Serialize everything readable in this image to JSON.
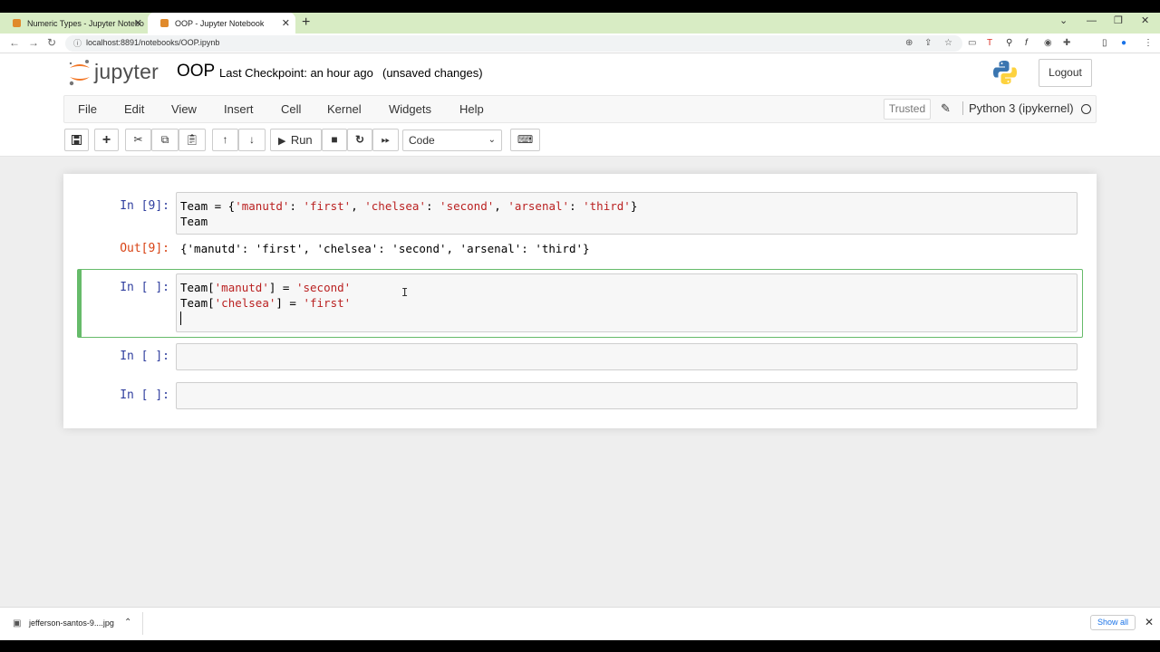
{
  "browser": {
    "tabs": [
      {
        "label": "Numeric Types - Jupyter Notebo"
      },
      {
        "label": "OOP - Jupyter Notebook"
      }
    ],
    "url": "localhost:8891/notebooks/OOP.ipynb"
  },
  "header": {
    "logo_text": "jupyter",
    "notebook_name": "OOP",
    "checkpoint": "Last Checkpoint: an hour ago",
    "unsaved": "(unsaved changes)",
    "logout": "Logout"
  },
  "menu": {
    "items": [
      "File",
      "Edit",
      "View",
      "Insert",
      "Cell",
      "Kernel",
      "Widgets",
      "Help"
    ],
    "trusted": "Trusted",
    "kernel": "Python 3 (ipykernel)"
  },
  "toolbar": {
    "run_label": "Run",
    "cell_type": "Code"
  },
  "cells": [
    {
      "in": "In [9]:",
      "code": [
        "Team = {'manutd': 'first', 'chelsea': 'second', 'arsenal': 'third'}",
        "Team"
      ],
      "out": "Out[9]:",
      "output": "{'manutd': 'first', 'chelsea': 'second', 'arsenal': 'third'}"
    },
    {
      "in": "In [ ]:",
      "code": [
        "Team['manutd'] = 'second'",
        "Team['chelsea'] = 'first'"
      ]
    },
    {
      "in": "In [ ]:"
    },
    {
      "in": "In [ ]:"
    }
  ],
  "downloads": {
    "file": "jefferson-santos-9....jpg",
    "show_all": "Show all"
  },
  "colors": {
    "selected_cell_border": "#66bb6a",
    "in_prompt": "#303f9f",
    "out_prompt": "#d84315",
    "string": "#ba2121"
  }
}
